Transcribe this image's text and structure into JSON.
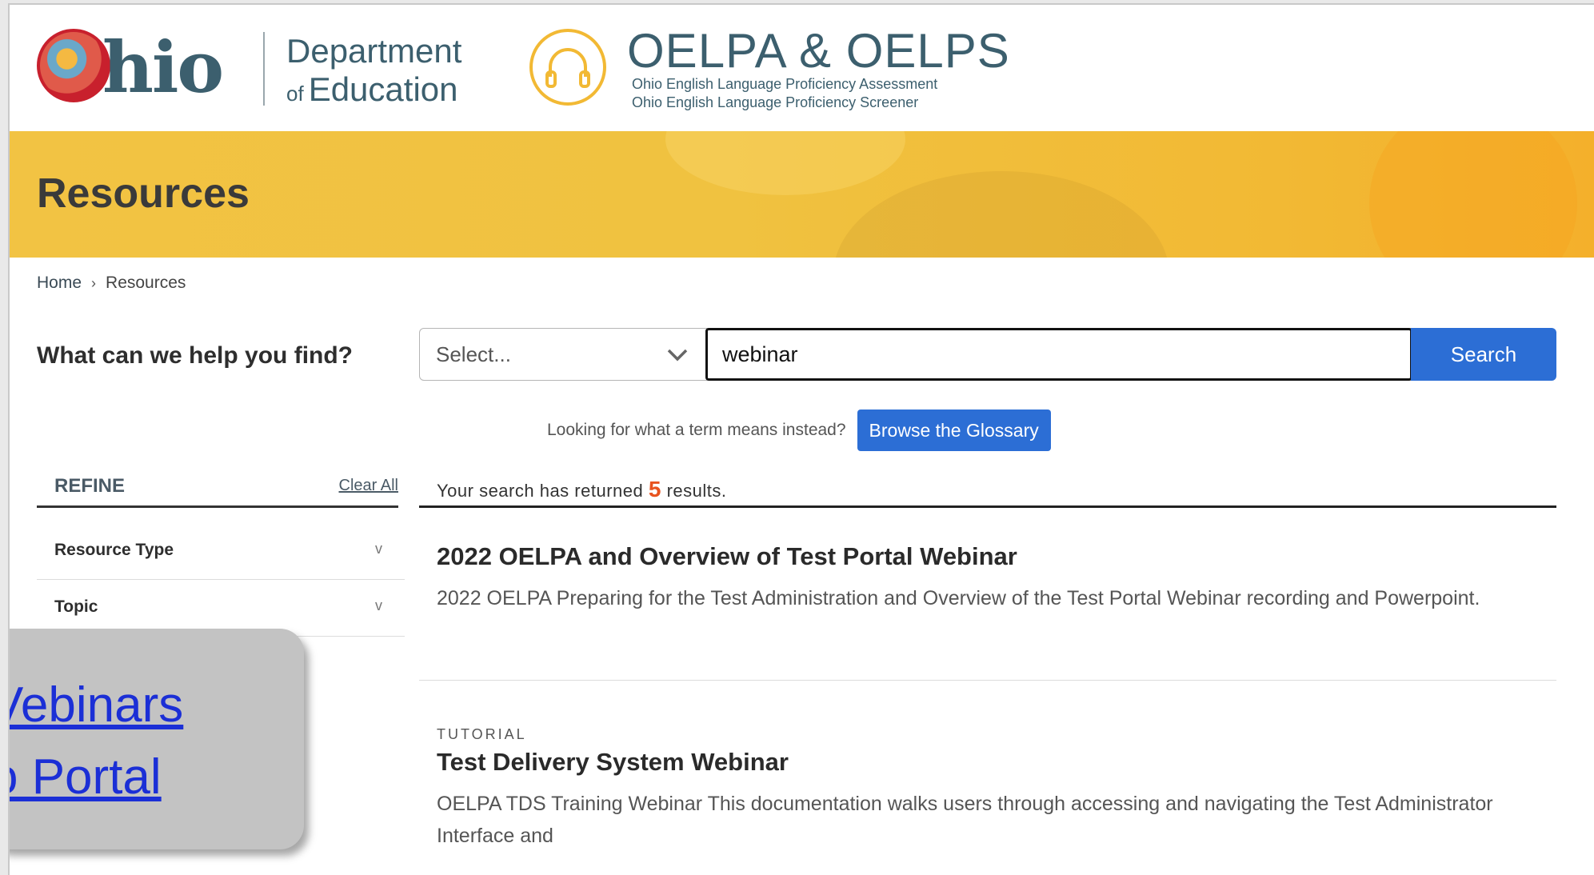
{
  "header": {
    "ohio_word": "hio",
    "dept_line1": "Department",
    "dept_of": "of",
    "dept_line2": "Education",
    "oelpa_title": "OELPA & OELPS",
    "oelpa_sub1": "Ohio English Language Proficiency Assessment",
    "oelpa_sub2": "Ohio English Language Proficiency Screener"
  },
  "banner": {
    "title": "Resources"
  },
  "breadcrumb": {
    "home": "Home",
    "separator": "›",
    "current": "Resources"
  },
  "search": {
    "label": "What can we help you find?",
    "select_value": "Select...",
    "query": "webinar",
    "button": "Search",
    "glossary_prompt": "Looking for what a term means instead?",
    "glossary_button": "Browse the Glossary"
  },
  "refine": {
    "title": "REFINE",
    "clear": "Clear All",
    "facets": [
      {
        "label": "Resource Type",
        "chevron": "v"
      },
      {
        "label": "Topic",
        "chevron": "v"
      }
    ]
  },
  "results": {
    "count_prefix": "Your search has returned",
    "count": "5",
    "count_suffix": "results.",
    "items": [
      {
        "kind": "",
        "title": "2022 OELPA and Overview of Test Portal Webinar",
        "description": "2022 OELPA Preparing for the Test Administration and Overview of the Test Portal Webinar recording and Powerpoint."
      },
      {
        "kind": "TUTORIAL",
        "title": "Test Delivery System Webinar",
        "description": "OELPA TDS Training Webinar This documentation walks users through accessing and navigating the Test Administrator Interface and"
      }
    ]
  },
  "overlay": {
    "link1": "Vebinars",
    "link2": "o Portal"
  },
  "colors": {
    "accent_blue": "#2c6ed5",
    "banner_yellow": "#f2c343",
    "count_orange": "#e8531f",
    "brand_teal": "#3c5f6e"
  },
  "icons": [
    "ohio-logo-icon",
    "headphones-icon",
    "chevron-down-icon"
  ]
}
